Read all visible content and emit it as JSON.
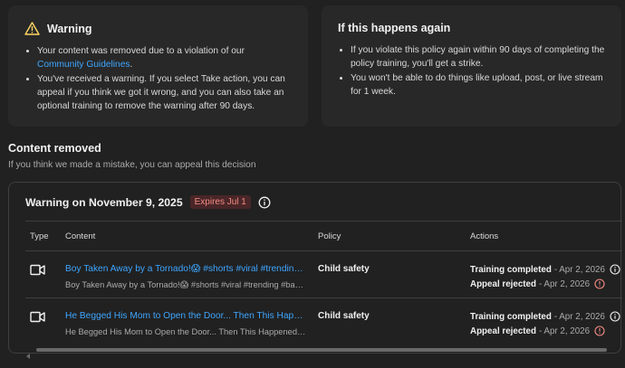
{
  "warning_card": {
    "title": "Warning",
    "bullet1_text": "Your content was removed due to a violation of our ",
    "bullet1_link": "Community Guidelines",
    "bullet1_end": ".",
    "bullet2": "You've received a warning. If you select Take action, you can appeal if you think we got it wrong, and you can also take an optional training to remove the warning after 90 days.",
    "icon": "warning-triangle-icon",
    "icon_color": "#fdd663"
  },
  "again_card": {
    "title": "If this happens again",
    "bullet1": "If you violate this policy again within 90 days of completing the policy training, you'll get a strike.",
    "bullet2": "You won't be able to do things like upload, post, or live stream for 1 week."
  },
  "removed_section": {
    "title": "Content removed",
    "subtitle": "If you think we made a mistake, you can appeal this decision"
  },
  "panel": {
    "title": "Warning on November 9, 2025",
    "badge": "Expires Jul 1",
    "badge_color": "#f28b82",
    "table": {
      "headers": {
        "type": "Type",
        "content": "Content",
        "policy": "Policy",
        "actions": "Actions"
      },
      "rows": [
        {
          "type_icon": "video-icon",
          "title": "Boy Taken Away by a Tornado!😱 #shorts #viral #trending #baby #tornado",
          "description": "Boy Taken Away by a Tornado!😱 #shorts #viral #trending #baby #tornado",
          "policy": "Child safety",
          "action1_label": "Training completed",
          "action1_date": "- Apr 2, 2026",
          "action2_label": "Appeal rejected",
          "action2_date": "- Apr 2, 2026"
        },
        {
          "type_icon": "video-icon",
          "title": "He Begged His Mom to Open the Door... Then This Happened!! #shorts",
          "description": "He Begged His Mom to Open the Door... Then This Happened!! #shorts",
          "policy": "Child safety",
          "action1_label": "Training completed",
          "action1_date": "- Apr 2, 2026",
          "action2_label": "Appeal rejected",
          "action2_date": "- Apr 2, 2026"
        }
      ]
    }
  },
  "colors": {
    "link": "#3ea6ff",
    "error_icon": "#f28b82",
    "background": "#212121",
    "card": "#282828"
  }
}
